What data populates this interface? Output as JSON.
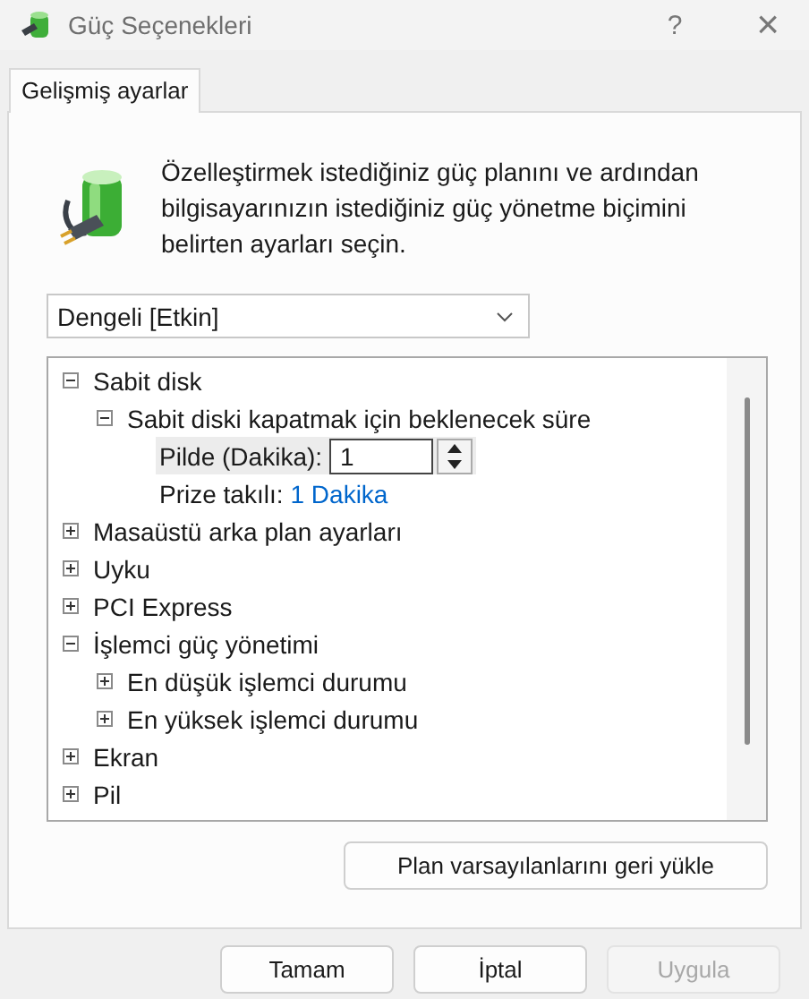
{
  "window": {
    "title": "Güç Seçenekleri",
    "help": "?",
    "close": "×"
  },
  "tabs": [
    {
      "label": "Gelişmiş ayarlar",
      "selected": true
    }
  ],
  "intro": "Özelleştirmek istediğiniz güç planını ve ardından bilgisayarınızın istediğiniz güç yönetme biçimini belirten ayarları seçin.",
  "plan_dropdown": {
    "value": "Dengeli [Etkin]"
  },
  "settings_tree": [
    {
      "label": "Sabit disk",
      "expanded": true,
      "children": [
        {
          "label": "Sabit diski kapatmak için beklenecek süre",
          "expanded": true,
          "children": [
            {
              "kind": "spin",
              "label": "Pilde (Dakika):",
              "value": "1",
              "selected": true
            },
            {
              "kind": "link",
              "label": "Prize takılı:",
              "value": "1 Dakika",
              "selected": false
            }
          ]
        }
      ]
    },
    {
      "label": "Masaüstü arka plan ayarları",
      "expanded": false
    },
    {
      "label": "Uyku",
      "expanded": false
    },
    {
      "label": "PCI Express",
      "expanded": false
    },
    {
      "label": "İşlemci güç yönetimi",
      "expanded": true,
      "children": [
        {
          "label": "En düşük işlemci durumu",
          "expanded": false
        },
        {
          "label": "En yüksek işlemci durumu",
          "expanded": false
        }
      ]
    },
    {
      "label": "Ekran",
      "expanded": false
    },
    {
      "label": "Pil",
      "expanded": false
    }
  ],
  "restore_button": "Plan varsayılanlarını geri yükle",
  "buttons": [
    {
      "label": "Tamam",
      "disabled": false
    },
    {
      "label": "İptal",
      "disabled": false
    },
    {
      "label": "Uygula",
      "disabled": true
    }
  ]
}
